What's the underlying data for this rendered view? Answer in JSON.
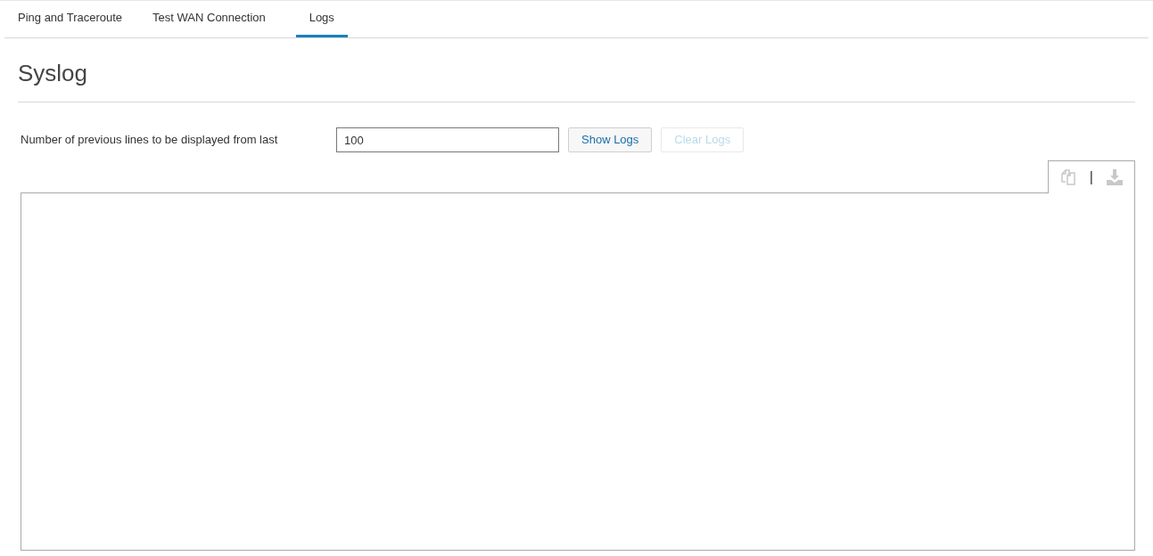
{
  "tabs": [
    {
      "label": "Ping and Traceroute",
      "selected": false
    },
    {
      "label": "Test WAN Connection",
      "selected": false
    },
    {
      "label": "Logs",
      "selected": true
    }
  ],
  "title": "Syslog",
  "lines_field": {
    "label": "Number of previous lines to be displayed from last",
    "value": "100"
  },
  "buttons": [
    {
      "label": "Show Logs",
      "disabled": false
    },
    {
      "label": "Clear Logs",
      "disabled": true
    }
  ],
  "log_toolbar": {
    "separator": "|",
    "copy_disabled": true,
    "download_disabled": true
  }
}
